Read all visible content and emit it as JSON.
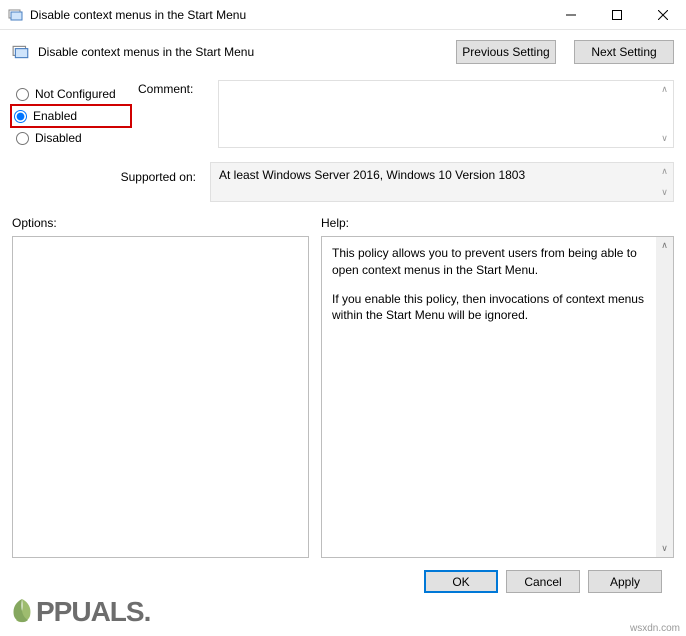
{
  "window": {
    "title": "Disable context menus in the Start Menu"
  },
  "header": {
    "policy_title": "Disable context menus in the Start Menu",
    "previous_label": "Previous Setting",
    "next_label": "Next Setting"
  },
  "settings": {
    "not_configured_label": "Not Configured",
    "enabled_label": "Enabled",
    "disabled_label": "Disabled",
    "selected": "enabled",
    "comment_label": "Comment:",
    "comment_value": "",
    "supported_label": "Supported on:",
    "supported_value": "At least Windows Server 2016, Windows 10 Version 1803"
  },
  "panels": {
    "options_label": "Options:",
    "help_label": "Help:",
    "help_text_1": "This policy allows you to prevent users from being able to open context menus in the Start Menu.",
    "help_text_2": "If you enable this policy, then invocations of context menus within the Start Menu will be ignored."
  },
  "footer": {
    "ok_label": "OK",
    "cancel_label": "Cancel",
    "apply_label": "Apply"
  },
  "watermark": {
    "text": "PPUALS.",
    "source": "wsxdn.com"
  }
}
